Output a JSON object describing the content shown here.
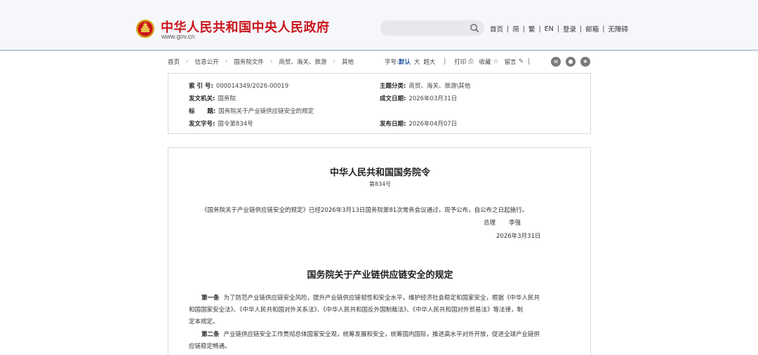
{
  "header": {
    "site_title": "中华人民共和国中央人民政府",
    "site_url": "www.gov.cn",
    "search_placeholder": "",
    "nav": [
      "首页",
      "简",
      "繁",
      "EN",
      "登录",
      "邮箱",
      "无障碍"
    ]
  },
  "breadcrumb": [
    "首页",
    "信息公开",
    "国务院文件",
    "商贸、海关、旅游",
    "其他"
  ],
  "toolbar": {
    "font_label": "字号:",
    "font_default": "默认",
    "font_large": "大",
    "font_xlarge": "超大",
    "print": "打印",
    "favorite": "收藏",
    "comment": "留言"
  },
  "meta": {
    "index_label": "索 引 号:",
    "index_value": "000014349/2026-00019",
    "topic_label": "主题分类:",
    "topic_value": "商贸、海关、旅游\\其他",
    "issuer_label": "发文机关:",
    "issuer_value": "国务院",
    "date_written_label": "成文日期:",
    "date_written_value": "2026年03月31日",
    "title_label": "标      题:",
    "title_value": "国务院关于产业链供应链安全的规定",
    "doc_no_label": "发文字号:",
    "doc_no_value": "国令第834号",
    "publish_date_label": "发布日期:",
    "publish_date_value": "2026年04月07日"
  },
  "document": {
    "order_title": "中华人民共和国国务院令",
    "order_no": "第834号",
    "announcement": "《国务院关于产业链供应链安全的规定》已经2026年3月13日国务院第81次常务会议通过，现予公布，自公布之日起施行。",
    "signer_title": "总理",
    "signer_name": "李强",
    "sign_date": "2026年3月31日",
    "regulation_title": "国务院关于产业链供应链安全的规定",
    "articles": [
      {
        "label": "第一条",
        "line1": "为了防范产业链供应链安全风险，提升产业链供应链韧性和安全水平，维护经济社会稳定和国家安全，根据《中华人民共",
        "line2": "和国国家安全法》、《中华人民共和国对外关系法》、《中华人民共和国反外国制裁法》、《中华人民共和国对外贸易法》等法律，制",
        "line3": "定本规定。"
      },
      {
        "label": "第二条",
        "line1": "产业链供应链安全工作贯彻总体国家安全观，统筹发展和安全，统筹国内国际，推进高水平对外开放，促进全球产业链供",
        "line2": "应链稳定畅通。"
      }
    ]
  },
  "colors": {
    "brand_red": "#c8141c",
    "link_blue": "#2a5aa8",
    "header_bg": "#f6f7fa"
  }
}
